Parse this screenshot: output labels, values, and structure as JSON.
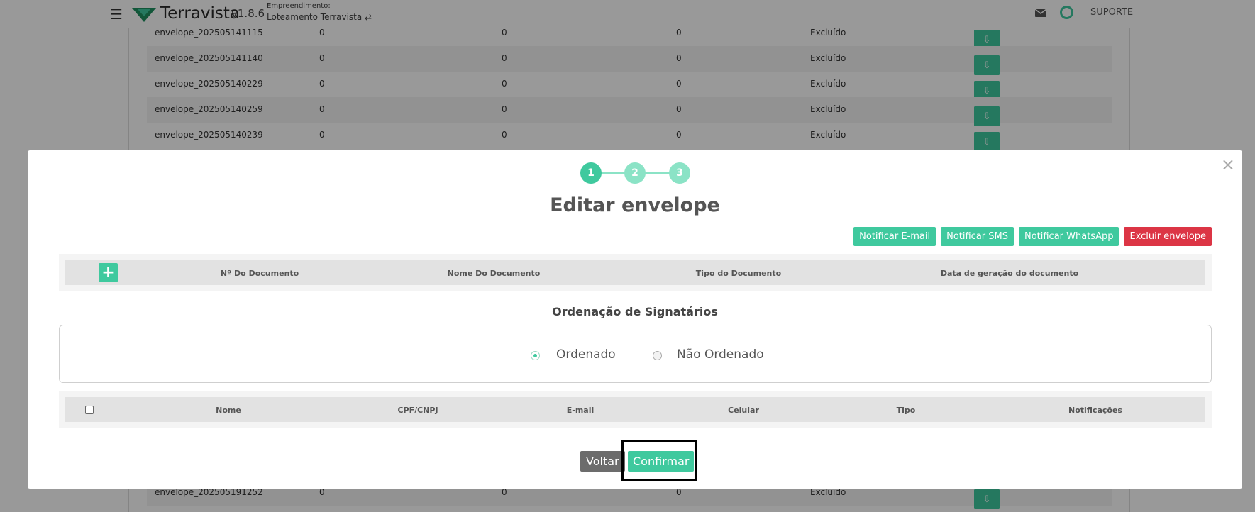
{
  "app": {
    "brand": "Terravista",
    "version": "v1.8.6",
    "empreendimento_label": "Empreendimento:",
    "empreendimento_name": "Loteamento Terravista ⇄",
    "support_label": "SUPORTE",
    "menu_icon": "☰",
    "menu_icon_name": "hamburger-icon",
    "mail_icon_name": "mail-icon",
    "status_icon_name": "status-ring-icon"
  },
  "background_rows": [
    {
      "name": "envelope_202505141115",
      "a": "0",
      "b": "0",
      "c": "0",
      "status": "Excluído"
    },
    {
      "name": "envelope_202505141140",
      "a": "0",
      "b": "0",
      "c": "0",
      "status": "Excluído"
    },
    {
      "name": "envelope_202505140229",
      "a": "0",
      "b": "0",
      "c": "0",
      "status": "Excluído"
    },
    {
      "name": "envelope_202505140259",
      "a": "0",
      "b": "0",
      "c": "0",
      "status": "Excluído"
    },
    {
      "name": "envelope_202505140239",
      "a": "0",
      "b": "0",
      "c": "0",
      "status": "Excluído"
    },
    {
      "name": "envelope_202505191252",
      "a": "0",
      "b": "0",
      "c": "0",
      "status": "Excluído"
    }
  ],
  "row_action_icons": [
    "eye-icon",
    "download-archive-icon",
    "download-file-icon"
  ],
  "modal": {
    "close": "×",
    "steps": [
      "1",
      "2",
      "3"
    ],
    "active_step": 1,
    "title": "Editar envelope",
    "actions": [
      {
        "label": "Notificar E-mail",
        "style": "green"
      },
      {
        "label": "Notificar SMS",
        "style": "green"
      },
      {
        "label": "Notificar WhatsApp",
        "style": "green"
      },
      {
        "label": "Excluir envelope",
        "style": "red"
      }
    ],
    "doc_table": {
      "add_label": "+",
      "columns": [
        "Nº Do Documento",
        "Nome Do Documento",
        "Tipo do Documento",
        "Data de geração do documento"
      ]
    },
    "ordering": {
      "title": "Ordenação de Signatários",
      "options": [
        {
          "label": "Ordenado",
          "selected": true
        },
        {
          "label": "Não Ordenado",
          "selected": false
        }
      ]
    },
    "signers_table": {
      "columns": [
        "Nome",
        "CPF/CNPJ",
        "E-mail",
        "Celular",
        "Tipo",
        "Notificações"
      ]
    },
    "footer": {
      "back_label": "Voltar",
      "confirm_label": "Confirmar"
    }
  },
  "colors": {
    "accent": "#3fc99e",
    "accent_light": "#8be3c6",
    "danger": "#dc3545",
    "secondary": "#6c6c6c"
  }
}
